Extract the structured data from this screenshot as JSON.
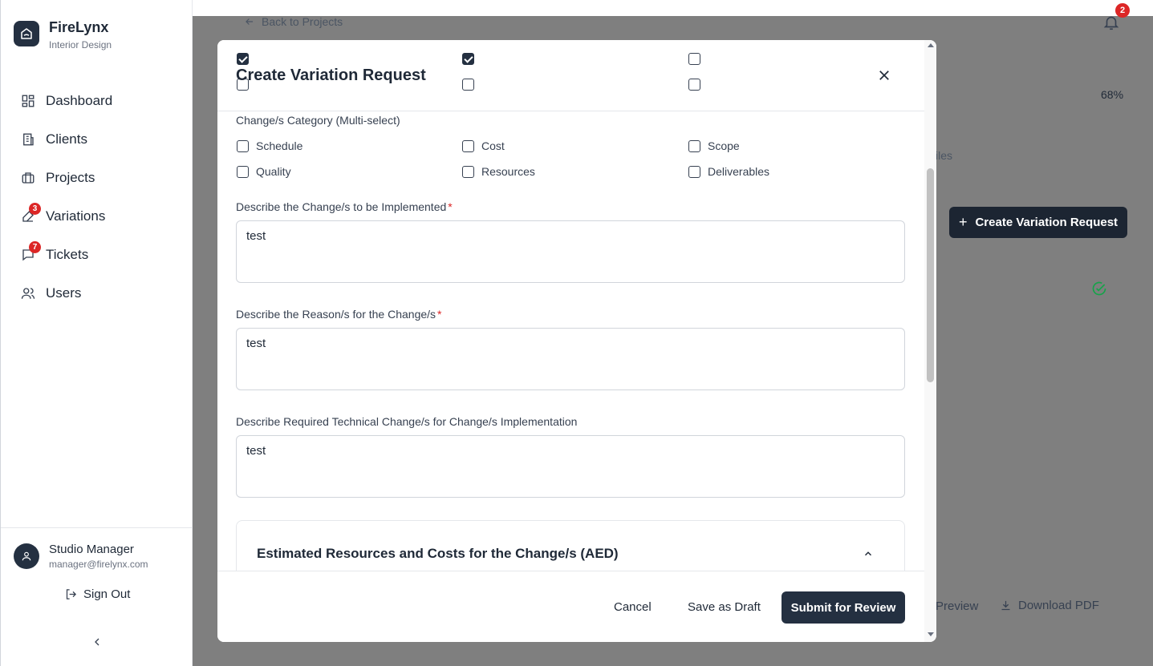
{
  "brand": {
    "name": "FireLynx",
    "subtitle": "Interior Design"
  },
  "sidebar": {
    "items": [
      {
        "label": "Dashboard",
        "icon": "dashboard-icon"
      },
      {
        "label": "Clients",
        "icon": "building-icon"
      },
      {
        "label": "Projects",
        "icon": "briefcase-icon"
      },
      {
        "label": "Variations",
        "icon": "edit-icon",
        "badge": "3"
      },
      {
        "label": "Tickets",
        "icon": "message-icon",
        "badge": "7"
      },
      {
        "label": "Users",
        "icon": "users-icon"
      }
    ],
    "user": {
      "name": "Studio Manager",
      "email": "manager@firelynx.com"
    },
    "signout_label": "Sign Out"
  },
  "header": {
    "back_label": "Back to Projects",
    "notification_count": "2"
  },
  "background": {
    "progress_label": "68%",
    "tab_fragment": "iles",
    "create_button_label": "Create Variation Request",
    "preview_fragment": "Preview",
    "download_label": "Download PDF"
  },
  "modal": {
    "title": "Create Variation Request",
    "header_checkboxes": [
      {
        "checked": true
      },
      {
        "checked": true
      },
      {
        "checked": false
      },
      {
        "checked": false
      },
      {
        "checked": false
      },
      {
        "checked": false
      }
    ],
    "category_label": "Change/s Category (Multi-select)",
    "categories": [
      {
        "label": "Schedule",
        "checked": false
      },
      {
        "label": "Cost",
        "checked": false
      },
      {
        "label": "Scope",
        "checked": false
      },
      {
        "label": "Quality",
        "checked": false
      },
      {
        "label": "Resources",
        "checked": false
      },
      {
        "label": "Deliverables",
        "checked": false
      }
    ],
    "fields": [
      {
        "label": "Describe the Change/s to be Implemented",
        "required": "*",
        "value": "test"
      },
      {
        "label": "Describe the Reason/s for the Change/s",
        "required": "*",
        "value": "test"
      },
      {
        "label": "Describe Required Technical Change/s for Change/s Implementation",
        "required": "",
        "value": "test"
      }
    ],
    "accordion_title": "Estimated Resources and Costs for the Change/s (AED)",
    "footer": {
      "cancel": "Cancel",
      "save_draft": "Save as Draft",
      "submit": "Submit for Review"
    }
  },
  "colors": {
    "primary": "#243041",
    "badge": "#dc2626",
    "success": "#16a34a"
  }
}
